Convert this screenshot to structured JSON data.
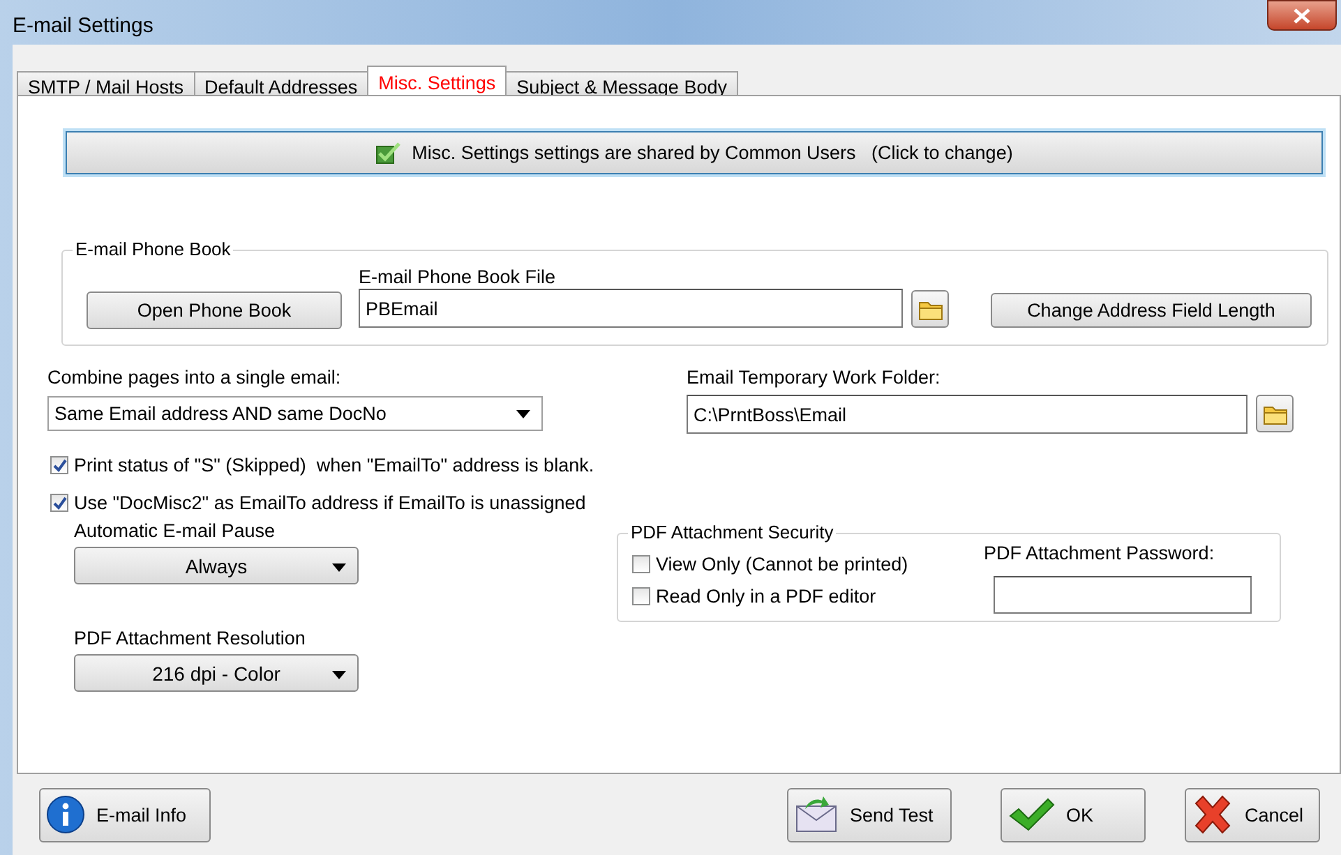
{
  "window": {
    "title": "E-mail Settings"
  },
  "tabs": [
    {
      "label": "SMTP / Mail Hosts",
      "selected": false
    },
    {
      "label": "Default Addresses",
      "selected": false
    },
    {
      "label": "Misc. Settings",
      "selected": true
    },
    {
      "label": "Subject & Message Body",
      "selected": false
    }
  ],
  "shared_button": {
    "label": "Misc. Settings settings are shared by Common Users   (Click to change)",
    "checked": true
  },
  "phone_book": {
    "legend": "E-mail Phone Book",
    "open_button": "Open Phone Book",
    "file_label": "E-mail Phone Book File",
    "file_value": "PBEmail",
    "change_button": "Change Address Field Length"
  },
  "combine": {
    "label": "Combine pages into a single email:",
    "value": "Same Email address AND same DocNo"
  },
  "temp_folder": {
    "label": "Email Temporary Work Folder:",
    "value": "C:\\PrntBoss\\Email"
  },
  "options": [
    {
      "label": "Print status of \"S\" (Skipped)  when \"EmailTo\" address is blank.",
      "checked": true
    },
    {
      "label": "Use \"DocMisc2\" as EmailTo address if EmailTo is unassigned",
      "checked": true
    }
  ],
  "pause": {
    "label": "Automatic E-mail Pause",
    "value": "Always"
  },
  "resolution": {
    "label": "PDF Attachment Resolution",
    "value": "216 dpi - Color"
  },
  "security": {
    "legend": "PDF Attachment Security",
    "options": [
      {
        "label": "View Only (Cannot be printed)",
        "checked": false
      },
      {
        "label": "Read Only in a PDF editor",
        "checked": false
      }
    ],
    "password_label": "PDF Attachment Password:"
  },
  "buttons": [
    {
      "kind": "info",
      "label": "E-mail Info"
    },
    {
      "kind": "send",
      "label": "Send Test"
    },
    {
      "kind": "ok",
      "label": "OK"
    },
    {
      "kind": "cancel",
      "label": "Cancel"
    }
  ]
}
